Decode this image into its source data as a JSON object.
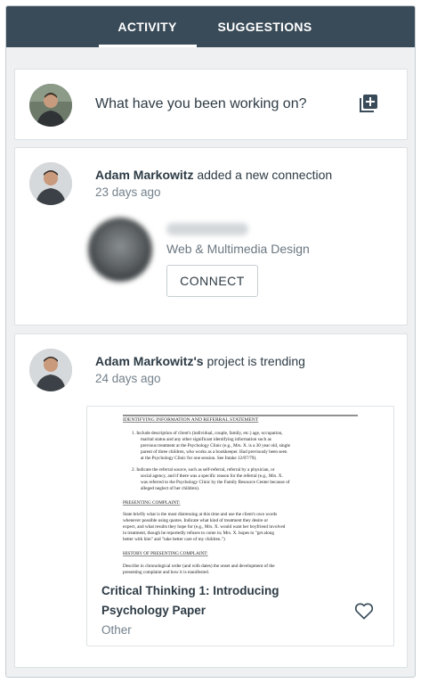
{
  "tabs": {
    "activity_label": "ACTIVITY",
    "suggestions_label": "SUGGESTIONS"
  },
  "composer": {
    "prompt": "What have you been working on?",
    "add_icon": "add-square-icon"
  },
  "feed": {
    "connection_item": {
      "user_name": "Adam Markowitz",
      "action_text": " added a new connection",
      "time_ago": "23 days ago",
      "connection": {
        "name_redacted": "",
        "department": "Web & Multimedia Design",
        "connect_label": "CONNECT"
      }
    },
    "project_item": {
      "user_name": "Adam Markowitz's",
      "action_text": " project is trending",
      "time_ago": "24 days ago",
      "project": {
        "title_line1": "Critical Thinking 1: Introducing",
        "title_line2": "Psychology Paper",
        "category": "Other",
        "like_icon": "heart-outline-icon",
        "thumbnail": {
          "heading": "IDENTIFYING INFORMATION AND REFERRAL STATEMENT",
          "item1": "1.  Include description of client's (individual, couple, family, etc.) age, occupation,",
          "item1b": "marital status and any other significant identifying information such as",
          "item1c": "previous treatment at the Psychology Clinic (e.g., Mrs. X. is a 30 year old, single",
          "item1d": "parent of three children, who works as a bookkeeper. Had previously been seen",
          "item1e": "at the Psychology Clinic for one session. See Intake 12/07/79).",
          "item2": "2.  Indicate the referral source, such as self-referral, referral by a physician, or",
          "item2b": "social agency, and if there was a specific reason for the referral (e.g., Mrs. X.",
          "item2c": "was referred to the Psychology Clinic by the Family Resource Center because of",
          "item2d": "alleged neglect of her children).",
          "section2": "PRESENTING COMPLAINT:",
          "para2a": "State briefly what is the most distressing at this time and use the client's own words",
          "para2b": "whenever possible using quotes. Indicate what kind of treatment they desire or",
          "para2c": "expect, and what results they hope for (e.g., Mrs. X. would want her boyfriend involved",
          "para2d": "in treatment, though he reportedly refuses to come in; Mrs. X. hopes to \"get along",
          "para2e": "better with him\" and \"take better care of my children.\")",
          "section3": "HISTORY OF PRESENTING COMPLAINT:",
          "para3a": "Describe in chronological order (and with dates) the onset and development of the",
          "para3b": "presenting complaint and how it is manifested."
        }
      }
    }
  },
  "colors": {
    "tab_bar": "#394b58",
    "page_bg": "#eef0f2",
    "text_primary": "#2d3b45",
    "text_muted": "#73818c"
  }
}
